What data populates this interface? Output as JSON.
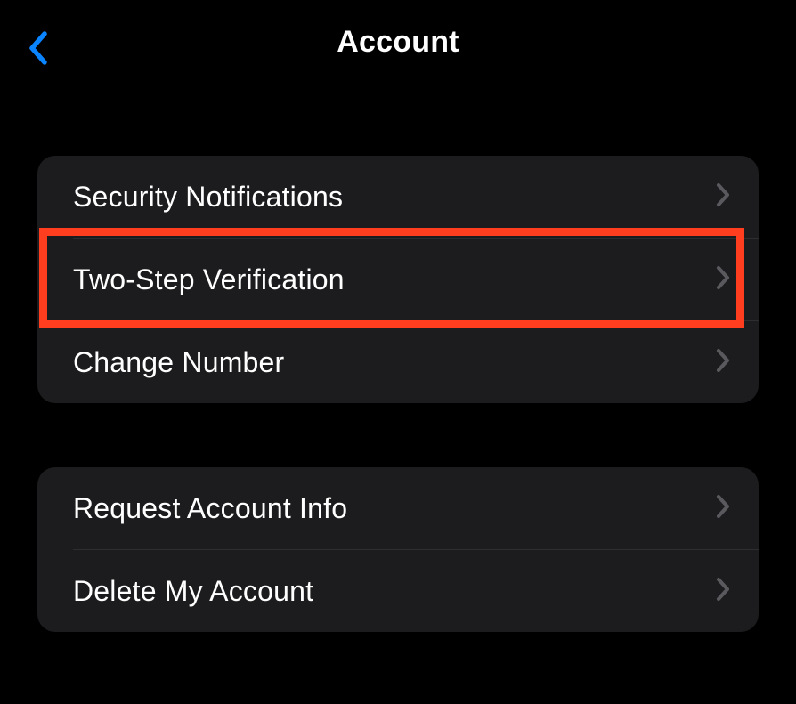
{
  "header": {
    "title": "Account"
  },
  "sections": [
    {
      "rows": [
        {
          "label": "Security Notifications"
        },
        {
          "label": "Two-Step Verification",
          "highlighted": true
        },
        {
          "label": "Change Number"
        }
      ]
    },
    {
      "rows": [
        {
          "label": "Request Account Info"
        },
        {
          "label": "Delete My Account"
        }
      ]
    }
  ],
  "colors": {
    "back_chevron": "#0a84ff",
    "highlight_border": "#ff3d1f",
    "list_bg": "#1c1c1e",
    "disclosure": "#5a5a5e"
  }
}
